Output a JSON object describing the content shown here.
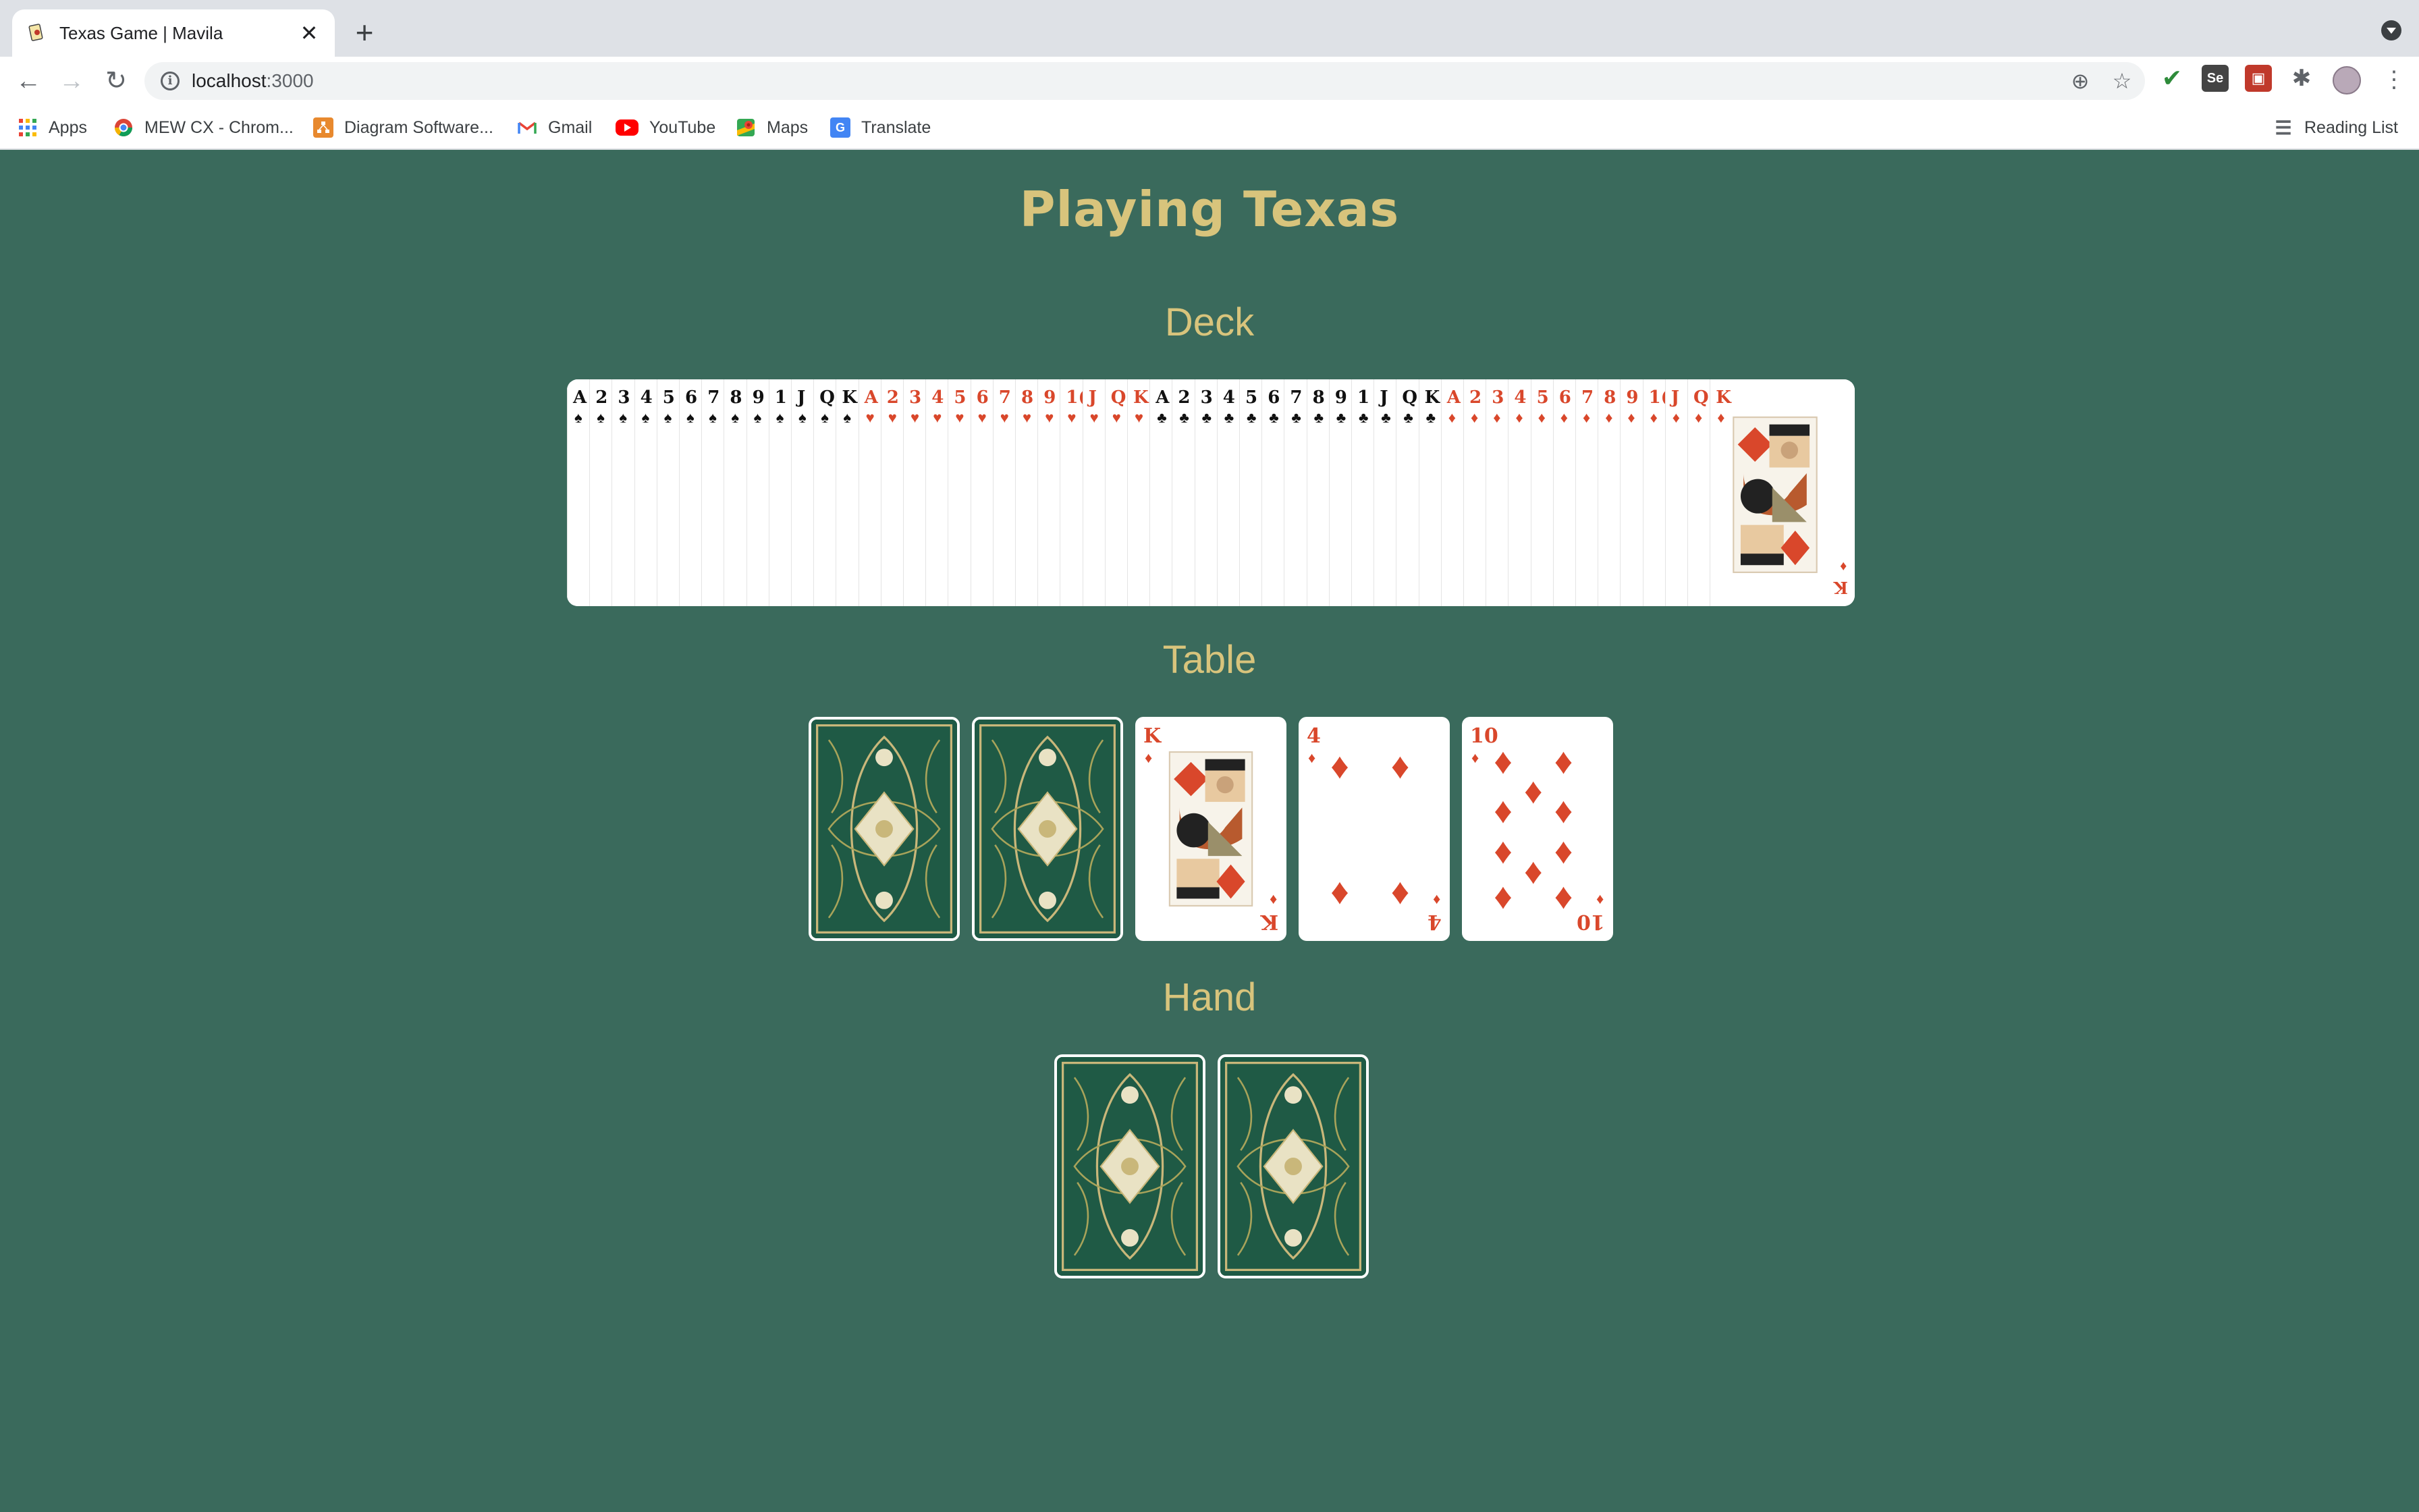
{
  "browser": {
    "tab_title": "Texas Game | Mavila",
    "new_tab": "+",
    "url_host": "localhost",
    "url_port": ":3000",
    "bookmarks": [
      {
        "label": "Apps",
        "icon": "apps-grid-icon"
      },
      {
        "label": "MEW CX - Chrom...",
        "icon": "chrome-icon"
      },
      {
        "label": "Diagram Software...",
        "icon": "diagram-icon"
      },
      {
        "label": "Gmail",
        "icon": "gmail-icon"
      },
      {
        "label": "YouTube",
        "icon": "youtube-icon"
      },
      {
        "label": "Maps",
        "icon": "maps-icon"
      },
      {
        "label": "Translate",
        "icon": "translate-icon"
      }
    ],
    "reading_list": "Reading List"
  },
  "page": {
    "title": "Playing Texas",
    "deck_heading": "Deck",
    "table_heading": "Table",
    "hand_heading": "Hand"
  },
  "deck": {
    "suits": [
      {
        "suit": "spades",
        "symbol": "♠",
        "color": "#111111",
        "ranks": [
          "A",
          "2",
          "3",
          "4",
          "5",
          "6",
          "7",
          "8",
          "9",
          "1",
          "J",
          "Q",
          "K"
        ]
      },
      {
        "suit": "hearts",
        "symbol": "♥",
        "color": "#d9472b",
        "ranks": [
          "A",
          "2",
          "3",
          "4",
          "5",
          "6",
          "7",
          "8",
          "9",
          "1(",
          "J",
          "Q",
          "K"
        ]
      },
      {
        "suit": "clubs",
        "symbol": "♣",
        "color": "#111111",
        "ranks": [
          "A",
          "2",
          "3",
          "4",
          "5",
          "6",
          "7",
          "8",
          "9",
          "1",
          "J",
          "Q",
          "K"
        ]
      },
      {
        "suit": "diamonds",
        "symbol": "♦",
        "color": "#d9472b",
        "ranks": [
          "A",
          "2",
          "3",
          "4",
          "5",
          "6",
          "7",
          "8",
          "9",
          "1(",
          "J",
          "Q",
          "K"
        ]
      }
    ],
    "top_card": {
      "rank": "K",
      "suit": "♦"
    }
  },
  "table": {
    "cards": [
      {
        "face": "down"
      },
      {
        "face": "down"
      },
      {
        "face": "up",
        "rank": "K",
        "suit": "♦"
      },
      {
        "face": "up",
        "rank": "4",
        "suit": "♦"
      },
      {
        "face": "up",
        "rank": "10",
        "suit": "♦"
      }
    ]
  },
  "hand": {
    "cards": [
      {
        "face": "down"
      },
      {
        "face": "down"
      }
    ]
  },
  "colors": {
    "background": "#3a6a5c",
    "heading": "#d8c47c",
    "red_suit": "#d9472b",
    "card_back": "#1f5a45"
  }
}
